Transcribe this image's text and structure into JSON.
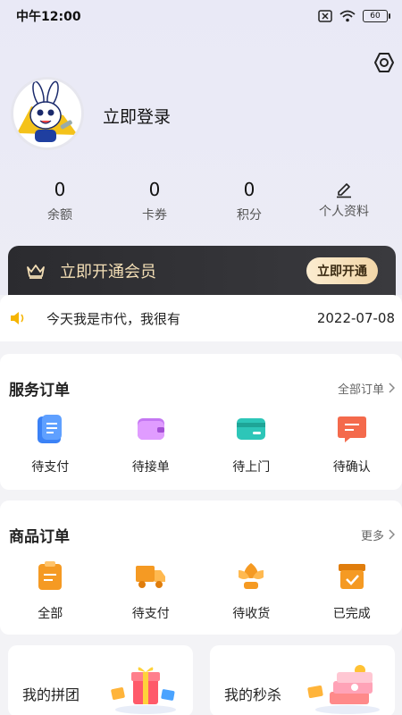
{
  "status": {
    "time": "中午12:00",
    "battery": "60"
  },
  "profile": {
    "login": "立即登录"
  },
  "stats": [
    {
      "value": "0",
      "label": "余额"
    },
    {
      "value": "0",
      "label": "卡券"
    },
    {
      "value": "0",
      "label": "积分"
    },
    {
      "label": "个人资料"
    }
  ],
  "vip": {
    "title": "立即开通会员",
    "button": "立即开通"
  },
  "notice": {
    "text": "今天我是市代，我很有",
    "date": "2022-07-08"
  },
  "service_orders": {
    "title": "服务订单",
    "more": "全部订单",
    "items": [
      {
        "label": "待支付",
        "icon": "doc-icon",
        "color": "#3b82f6"
      },
      {
        "label": "待接单",
        "icon": "wallet-icon",
        "color": "#c477f2"
      },
      {
        "label": "待上门",
        "icon": "card-icon",
        "color": "#2dc6b8"
      },
      {
        "label": "待确认",
        "icon": "chat-icon",
        "color": "#f46a4c"
      }
    ]
  },
  "goods_orders": {
    "title": "商品订单",
    "more": "更多",
    "items": [
      {
        "label": "全部",
        "icon": "clipboard-icon"
      },
      {
        "label": "待支付",
        "icon": "truck-icon"
      },
      {
        "label": "待收货",
        "icon": "flower-icon"
      },
      {
        "label": "已完成",
        "icon": "box-check-icon"
      }
    ]
  },
  "promos": [
    {
      "title": "我的拼团"
    },
    {
      "title": "我的秒杀"
    }
  ]
}
